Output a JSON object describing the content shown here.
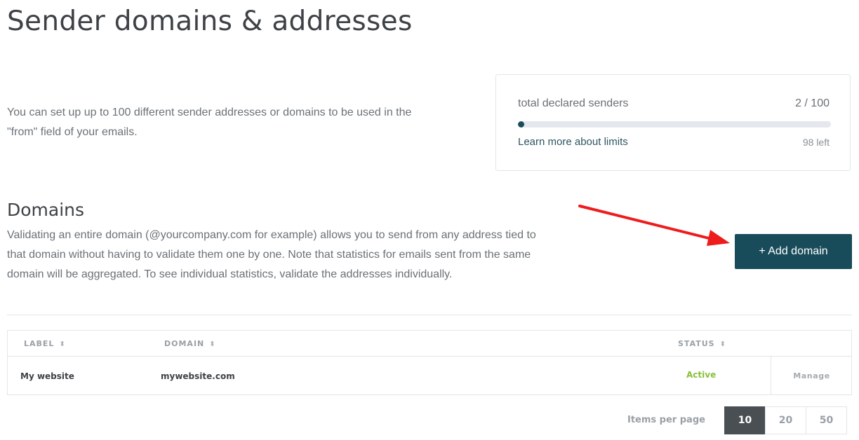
{
  "page": {
    "title": "Sender domains & addresses"
  },
  "intro": {
    "text": "You can set up up to 100 different sender addresses or domains to be used in the \"from\" field of your emails."
  },
  "limits": {
    "label": "total declared senders",
    "count": "2 / 100",
    "used": 2,
    "max": 100,
    "link": "Learn more about limits",
    "remaining": "98 left"
  },
  "domains": {
    "title": "Domains",
    "description": "Validating an entire domain (@yourcompany.com for example) allows you to send from any address tied to that domain without having to validate them one by one. Note that statistics for emails sent from the same domain will be aggregated. To see individual statistics, validate the addresses individually.",
    "add_button": "+ Add domain"
  },
  "table": {
    "columns": {
      "label": "LABEL",
      "domain": "DOMAIN",
      "status": "STATUS"
    },
    "sort_icon": "sort-arrows-icon",
    "rows": [
      {
        "label": "My website",
        "domain": "mywebsite.com",
        "status": "Active",
        "action": "Manage"
      }
    ]
  },
  "pagination": {
    "label": "Items per page",
    "options": [
      "10",
      "20",
      "50"
    ],
    "selected": "10"
  },
  "colors": {
    "primary": "#194c5a",
    "active_status": "#8bbf3a",
    "annotation_arrow": "#ee1c1c"
  }
}
